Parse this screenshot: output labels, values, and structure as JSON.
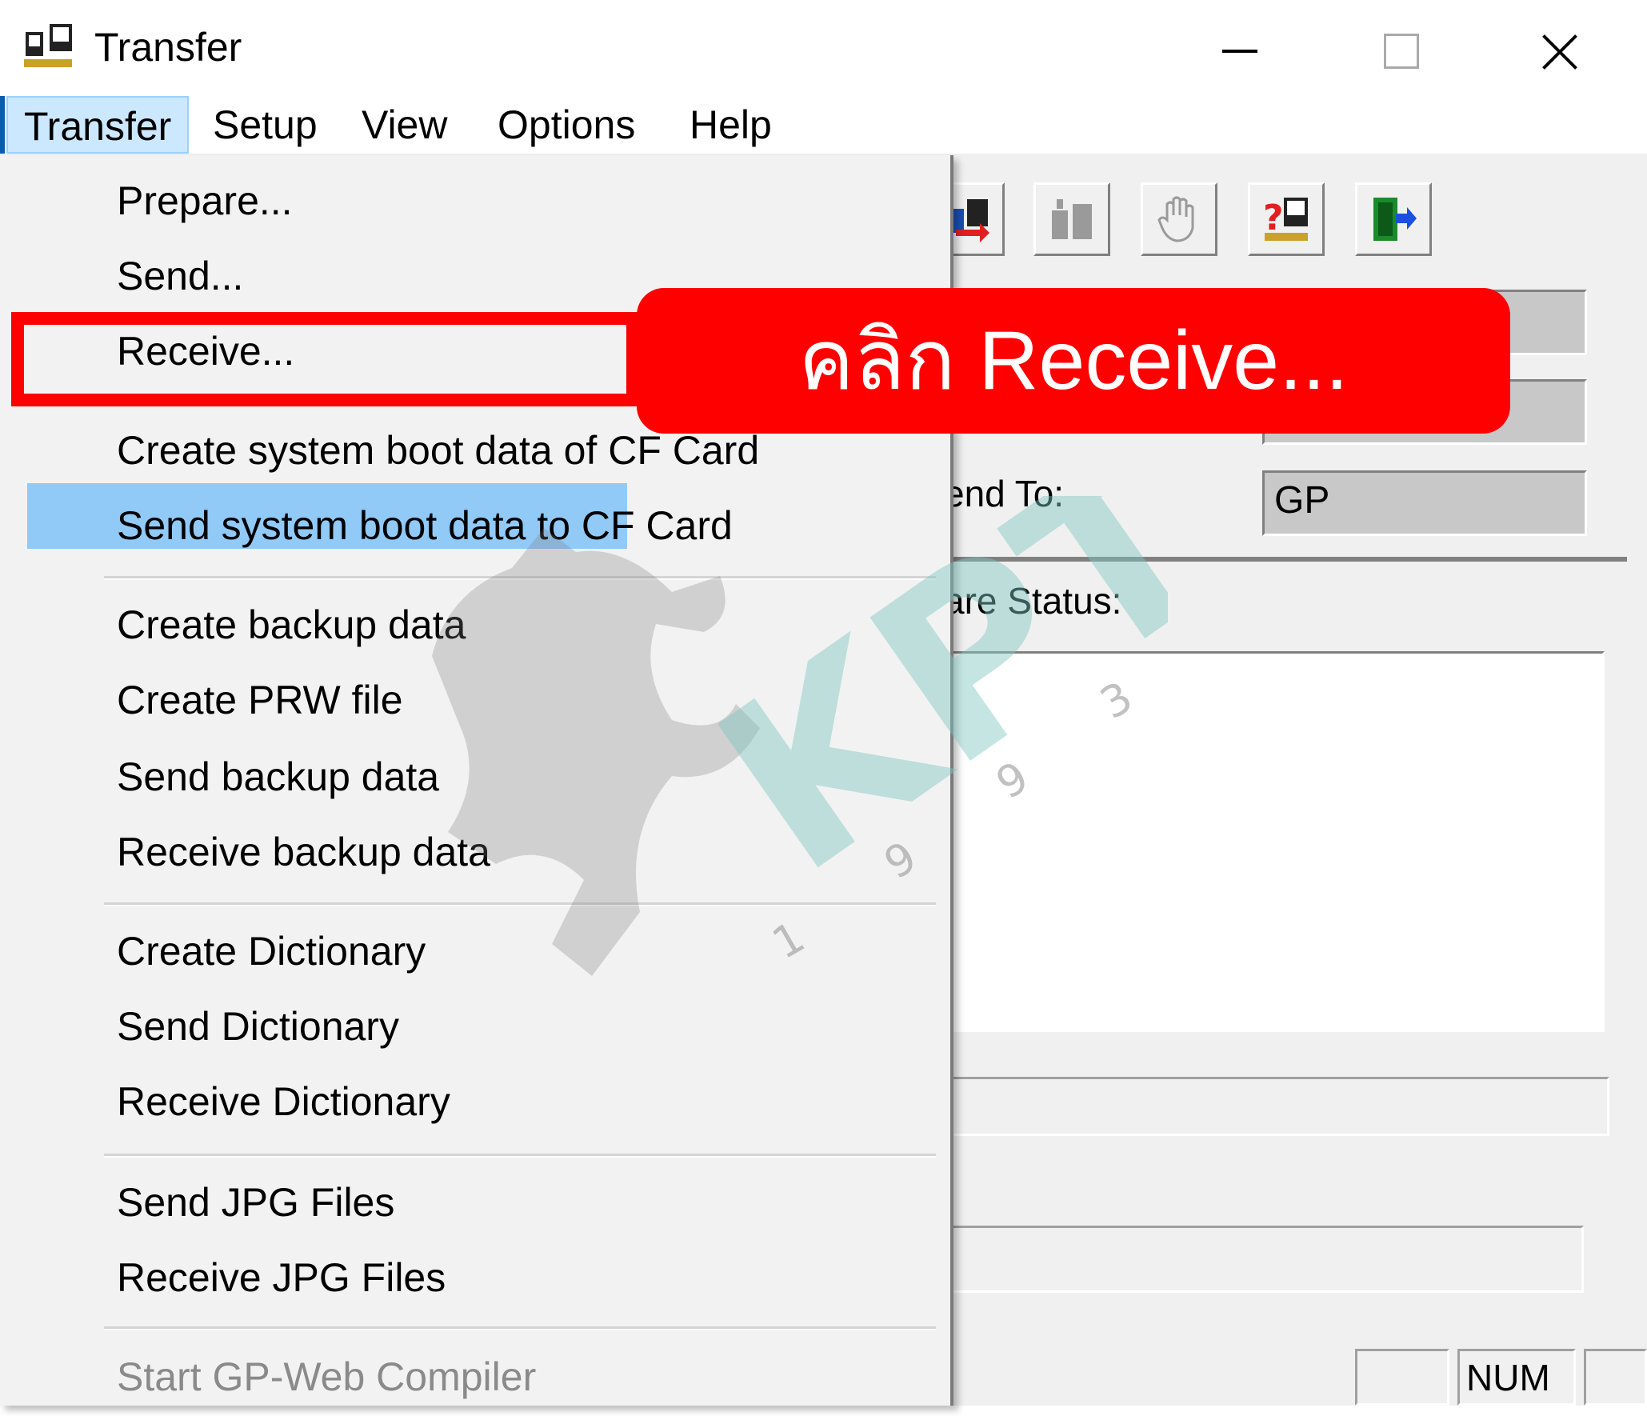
{
  "window": {
    "title": "Transfer",
    "icon": "transfer-app-icon"
  },
  "menubar": {
    "items": [
      "Transfer",
      "Setup",
      "View",
      "Options",
      "Help"
    ]
  },
  "dropdown": {
    "groups": [
      [
        "Prepare...",
        "Send...",
        "Receive...",
        "Create system boot data of CF Card",
        "Send system boot data to CF Card"
      ],
      [
        "Create backup data",
        "Create PRW file",
        "Send backup data",
        "Receive backup data"
      ],
      [
        "Create Dictionary",
        "Send Dictionary",
        "Receive Dictionary"
      ],
      [
        "Send JPG Files",
        "Receive JPG Files"
      ],
      [
        "Start GP-Web Compiler"
      ]
    ],
    "highlighted": "Receive...",
    "disabled": [
      "Start GP-Web Compiler"
    ]
  },
  "callout": {
    "text": "คลิก Receive..."
  },
  "main": {
    "send_to_label": "end To:",
    "send_to_value": "GP",
    "status_label": "are Status:"
  },
  "statusbar": {
    "num": "NUM"
  },
  "toolbar": {
    "icons": [
      "transfer-icon",
      "setup-icon",
      "stop-hand-icon",
      "help-icon",
      "exit-icon"
    ]
  },
  "watermark": {
    "text": "KPT",
    "digits": [
      "3",
      "9",
      "9",
      "1"
    ]
  },
  "colors": {
    "highlight": "#91c9f7",
    "callout": "#ff0000",
    "menu_active": "#cce8ff"
  }
}
